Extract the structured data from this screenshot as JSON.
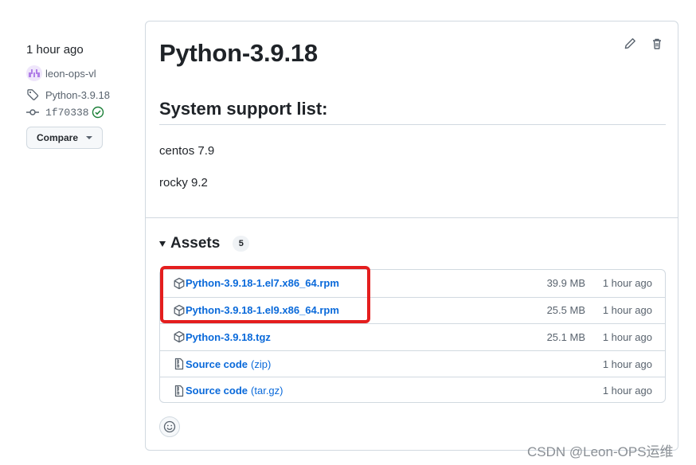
{
  "sidebar": {
    "time": "1 hour ago",
    "author": "leon-ops-vl",
    "tag": "Python-3.9.18",
    "commit": "1f70338",
    "compare_label": "Compare"
  },
  "release": {
    "title": "Python-3.9.18",
    "section_heading": "System support list:",
    "support_items": [
      "centos 7.9",
      "rocky 9.2"
    ]
  },
  "assets": {
    "heading": "Assets",
    "count": "5",
    "items": [
      {
        "name": "Python-3.9.18-1.el7.x86_64.rpm",
        "ext": "",
        "size": "39.9 MB",
        "time": "1 hour ago",
        "icon": "package-icon"
      },
      {
        "name": "Python-3.9.18-1.el9.x86_64.rpm",
        "ext": "",
        "size": "25.5 MB",
        "time": "1 hour ago",
        "icon": "package-icon"
      },
      {
        "name": "Python-3.9.18.tgz",
        "ext": "",
        "size": "25.1 MB",
        "time": "1 hour ago",
        "icon": "package-icon"
      },
      {
        "name": "Source code",
        "ext": "(zip)",
        "size": "",
        "time": "1 hour ago",
        "icon": "file-zip-icon"
      },
      {
        "name": "Source code",
        "ext": "(tar.gz)",
        "size": "",
        "time": "1 hour ago",
        "icon": "file-zip-icon"
      }
    ]
  },
  "watermark": "CSDN @Leon-OPS运维",
  "colors": {
    "link": "#0969da",
    "highlight": "#e41e1e",
    "verified": "#1a7f37",
    "border": "#d1d9e0"
  }
}
